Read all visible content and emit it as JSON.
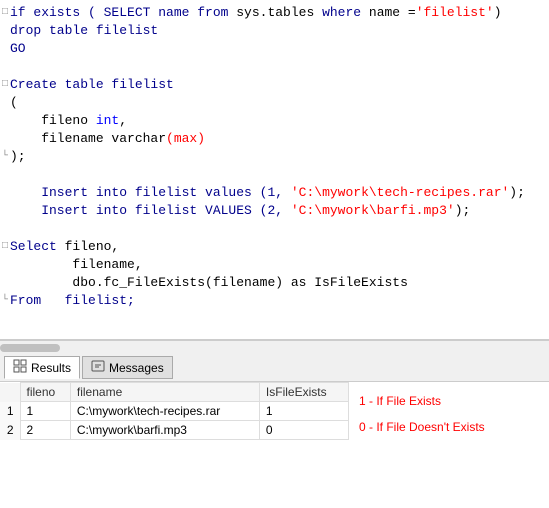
{
  "editor": {
    "lines": [
      {
        "indicator": "□",
        "has_indicator": true,
        "parts": [
          {
            "text": "if exists ( SELECT name ",
            "class": "kw"
          },
          {
            "text": "from",
            "class": "kw"
          },
          {
            "text": " sys.tables ",
            "class": ""
          },
          {
            "text": "where",
            "class": "kw"
          },
          {
            "text": " name =",
            "class": ""
          },
          {
            "text": "'filelist'",
            "class": "str"
          },
          {
            "text": ")",
            "class": ""
          }
        ]
      },
      {
        "indicator": "",
        "has_indicator": false,
        "parts": [
          {
            "text": "drop table filelist",
            "class": "kw"
          }
        ]
      },
      {
        "indicator": "",
        "has_indicator": false,
        "parts": [
          {
            "text": "GO",
            "class": "kw"
          }
        ]
      },
      {
        "indicator": "",
        "has_indicator": false,
        "parts": []
      },
      {
        "indicator": "□",
        "has_indicator": true,
        "parts": [
          {
            "text": "Create table filelist",
            "class": "kw"
          }
        ]
      },
      {
        "indicator": "",
        "has_indicator": false,
        "parts": [
          {
            "text": "(",
            "class": "punc"
          }
        ]
      },
      {
        "indicator": "",
        "has_indicator": false,
        "parts": [
          {
            "text": "    fileno ",
            "class": ""
          },
          {
            "text": "int",
            "class": "type"
          },
          {
            "text": ",",
            "class": ""
          }
        ]
      },
      {
        "indicator": "",
        "has_indicator": false,
        "parts": [
          {
            "text": "    filename varchar",
            "class": ""
          },
          {
            "text": "(max)",
            "class": "str"
          }
        ]
      },
      {
        "indicator": "└",
        "has_indicator": true,
        "parts": [
          {
            "text": ");",
            "class": "punc"
          }
        ]
      },
      {
        "indicator": "",
        "has_indicator": false,
        "parts": []
      },
      {
        "indicator": "",
        "has_indicator": false,
        "parts": [
          {
            "text": "    Insert into filelist values (1, ",
            "class": "kw"
          },
          {
            "text": "'C:\\mywork\\tech-recipes.rar'",
            "class": "str"
          },
          {
            "text": ");",
            "class": ""
          }
        ]
      },
      {
        "indicator": "",
        "has_indicator": false,
        "parts": [
          {
            "text": "    Insert into filelist VALUES (2, ",
            "class": "kw"
          },
          {
            "text": "'C:\\mywork\\barfi.mp3'",
            "class": "str"
          },
          {
            "text": ");",
            "class": ""
          }
        ]
      },
      {
        "indicator": "",
        "has_indicator": false,
        "parts": []
      },
      {
        "indicator": "□",
        "has_indicator": true,
        "parts": [
          {
            "text": "Select ",
            "class": "kw"
          },
          {
            "text": "fileno,",
            "class": ""
          }
        ]
      },
      {
        "indicator": "",
        "has_indicator": false,
        "parts": [
          {
            "text": "        filename,",
            "class": ""
          }
        ]
      },
      {
        "indicator": "",
        "has_indicator": false,
        "parts": [
          {
            "text": "        dbo.fc_FileExists(filename) as IsFileExists",
            "class": ""
          }
        ]
      },
      {
        "indicator": "└",
        "has_indicator": true,
        "parts": [
          {
            "text": "From   filelist;",
            "class": "kw"
          }
        ]
      }
    ]
  },
  "tabs": [
    {
      "label": "Results",
      "icon": "grid",
      "active": true
    },
    {
      "label": "Messages",
      "icon": "message",
      "active": false
    }
  ],
  "table": {
    "columns": [
      "fileno",
      "filename",
      "IsFileExists"
    ],
    "rows": [
      {
        "row_num": "1",
        "fileno": "1",
        "filename": "C:\\mywork\\tech-recipes.rar",
        "isfileexists": "1"
      },
      {
        "row_num": "2",
        "fileno": "2",
        "filename": "C:\\mywork\\barfi.mp3",
        "isfileexists": "0"
      }
    ]
  },
  "annotations": [
    "1 - If File Exists",
    "0 - If File Doesn't Exists"
  ]
}
